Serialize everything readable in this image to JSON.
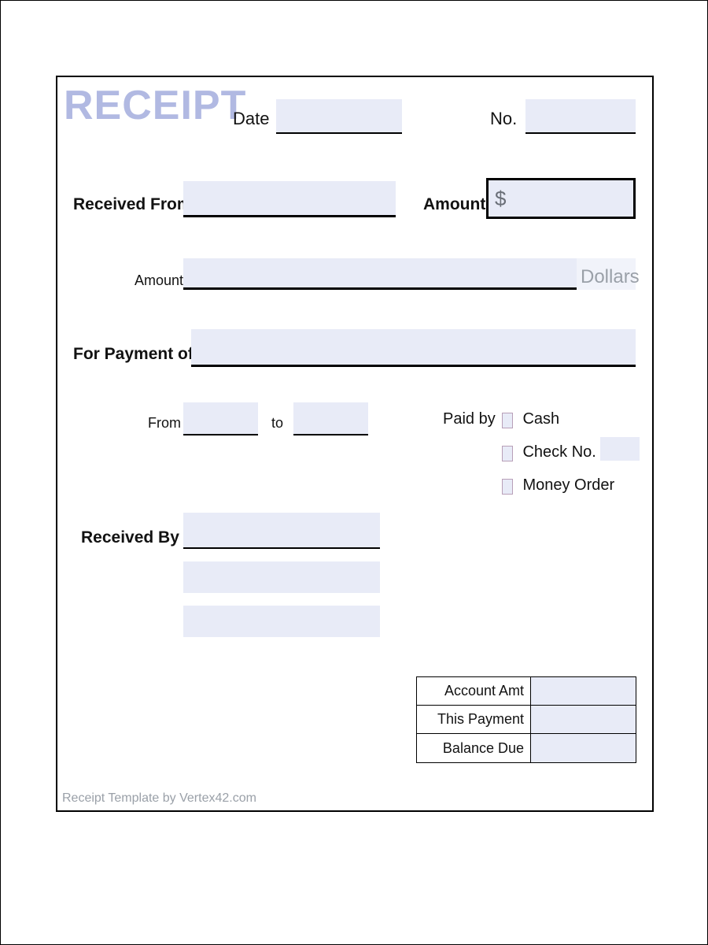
{
  "title": "RECEIPT",
  "header": {
    "date_label": "Date",
    "date_value": "",
    "no_label": "No.",
    "no_value": ""
  },
  "received_from": {
    "label": "Received From",
    "value": ""
  },
  "amount_box": {
    "label": "Amount",
    "currency": "$",
    "value": ""
  },
  "amount_words": {
    "label": "Amount",
    "value": "",
    "suffix": "Dollars"
  },
  "for_payment": {
    "label": "For Payment of",
    "value": ""
  },
  "period": {
    "from_label": "From",
    "from_value": "",
    "to_label": "to",
    "to_value": ""
  },
  "paid_by": {
    "label": "Paid by",
    "options": {
      "cash": "Cash",
      "check": "Check No.",
      "check_no_value": "",
      "money_order": "Money Order"
    }
  },
  "received_by": {
    "label": "Received By",
    "line1": "",
    "line2": "",
    "line3": ""
  },
  "summary": {
    "account_amt_label": "Account Amt",
    "account_amt_value": "",
    "this_payment_label": "This Payment",
    "this_payment_value": "",
    "balance_due_label": "Balance Due",
    "balance_due_value": ""
  },
  "footer": "Receipt Template by Vertex42.com"
}
